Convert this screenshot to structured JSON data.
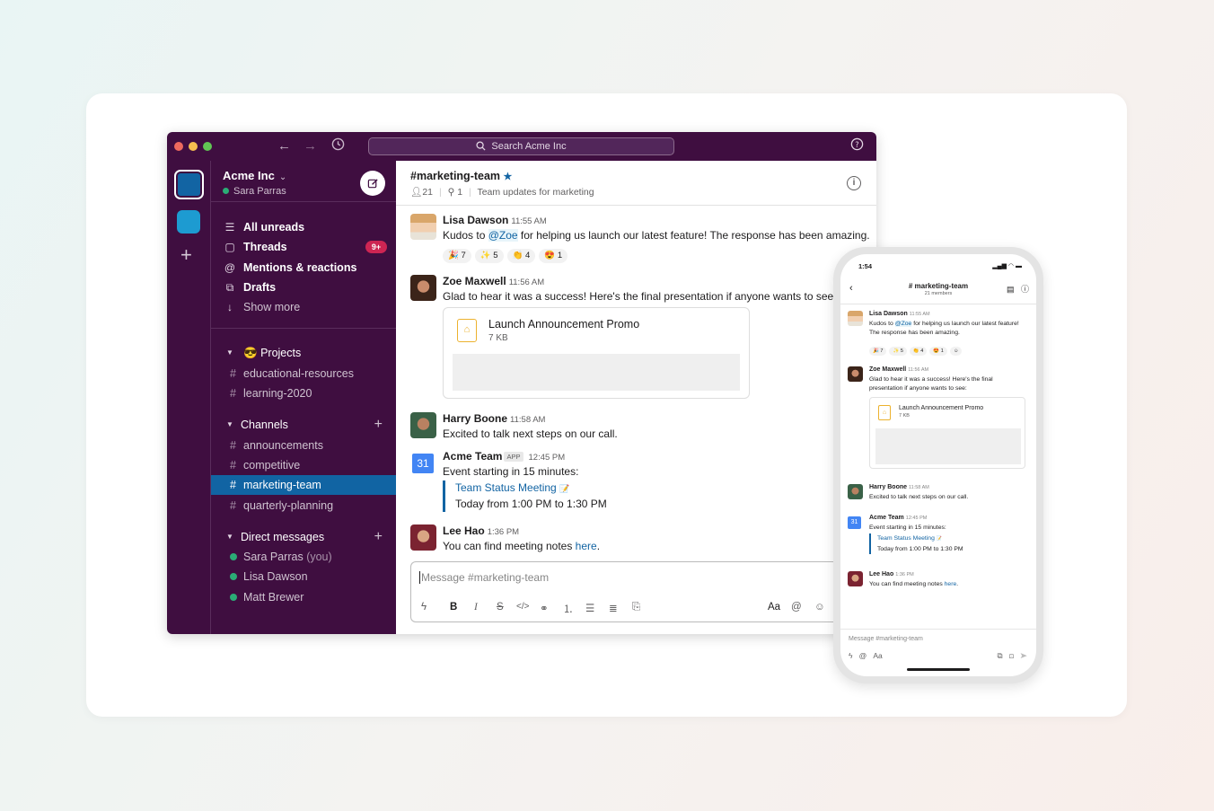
{
  "window": {
    "search_placeholder": "Search Acme Inc",
    "help_icon": "help-circle-icon"
  },
  "workspace": {
    "name": "Acme Inc",
    "user": "Sara Parras"
  },
  "nav": {
    "all_unreads": "All unreads",
    "threads": "Threads",
    "threads_badge": "9+",
    "mentions": "Mentions & reactions",
    "drafts": "Drafts",
    "show_more": "Show more"
  },
  "sections": {
    "projects": {
      "title": "Projects",
      "emoji": "😎",
      "items": [
        "educational-resources",
        "learning-2020"
      ]
    },
    "channels": {
      "title": "Channels",
      "items": [
        "announcements",
        "competitive",
        "marketing-team",
        "quarterly-planning"
      ],
      "selected": "marketing-team"
    },
    "dms": {
      "title": "Direct messages",
      "items": [
        {
          "name": "Sara Parras",
          "suffix": "(you)"
        },
        {
          "name": "Lisa Dawson",
          "suffix": ""
        },
        {
          "name": "Matt Brewer",
          "suffix": ""
        }
      ]
    }
  },
  "channel": {
    "name": "#marketing-team",
    "members": "21",
    "pins": "1",
    "topic": "Team updates for marketing"
  },
  "messages": {
    "m1": {
      "author": "Lisa Dawson",
      "time": "11:55 AM",
      "pre": "Kudos to ",
      "mention": "@Zoe",
      "post": " for helping us launch our latest feature! The response has been amazing.",
      "reactions": [
        {
          "emoji": "🎉",
          "count": "7"
        },
        {
          "emoji": "✨",
          "count": "5"
        },
        {
          "emoji": "👏",
          "count": "4"
        },
        {
          "emoji": "😍",
          "count": "1"
        }
      ]
    },
    "m2": {
      "author": "Zoe Maxwell",
      "time": "11:56 AM",
      "text": "Glad to hear it was a success! Here's the final presentation if anyone wants to see:",
      "file_name": "Launch Announcement Promo",
      "file_size": "7 KB"
    },
    "m3": {
      "author": "Harry Boone",
      "time": "11:58 AM",
      "text": "Excited to talk next steps on our call."
    },
    "m4": {
      "author": "Acme Team",
      "tag": "APP",
      "time": "12:45 PM",
      "text": "Event starting in 15 minutes:",
      "event_title": "Team Status Meeting",
      "event_time": "Today from 1:00 PM to 1:30 PM",
      "calendar_day": "31"
    },
    "m5": {
      "author": "Lee Hao",
      "time": "1:36 PM",
      "pre": "You can find meeting notes ",
      "link": "here",
      "post": "."
    }
  },
  "composer": {
    "placeholder": "Message #marketing-team",
    "text_style_label": "Aa"
  },
  "phone": {
    "clock": "1:54",
    "title": "# marketing-team",
    "subtitle": "21 members",
    "composer_placeholder": "Message #marketing-team",
    "text_style_label": "Aa"
  },
  "colors": {
    "aubergine": "#3f0e40",
    "selected": "#1164a3",
    "link": "#1264a3",
    "presence": "#2bac76",
    "badge": "#cd2553"
  }
}
